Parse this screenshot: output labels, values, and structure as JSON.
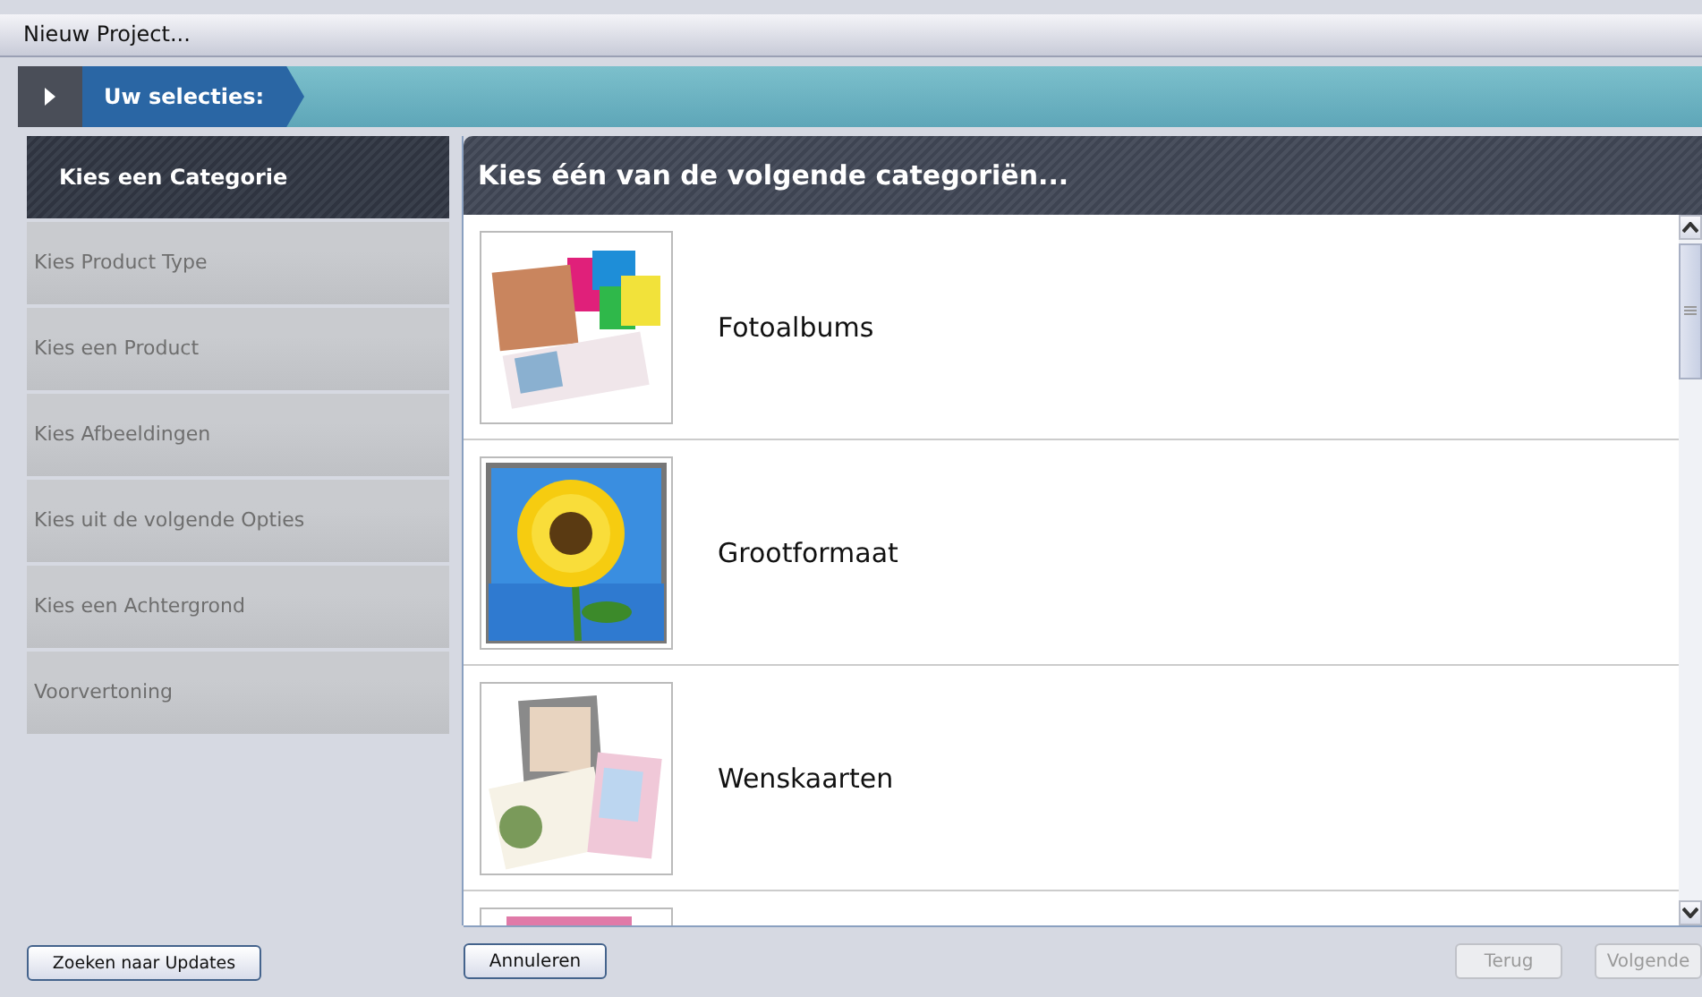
{
  "window": {
    "title": "Nieuw Project..."
  },
  "selection_bar": {
    "label": "Uw selecties:"
  },
  "steps": [
    {
      "label": "Kies een Categorie",
      "selected": true
    },
    {
      "label": "Kies Product Type",
      "selected": false
    },
    {
      "label": "Kies een Product",
      "selected": false
    },
    {
      "label": "Kies Afbeeldingen",
      "selected": false
    },
    {
      "label": "Kies uit de volgende Opties",
      "selected": false
    },
    {
      "label": "Kies een Achtergrond",
      "selected": false
    },
    {
      "label": "Voorvertoning",
      "selected": false
    }
  ],
  "panel": {
    "title": "Kies één van de volgende categoriën..."
  },
  "categories": [
    {
      "label": "Fotoalbums"
    },
    {
      "label": "Grootformaat"
    },
    {
      "label": "Wenskaarten"
    },
    {
      "kind": "picture"
    }
  ],
  "buttons": [
    {
      "label": "Zoeken naar Updates",
      "disabled": false
    },
    {
      "label": "Annuleren",
      "disabled": false
    },
    {
      "label": "Terug",
      "disabled": true
    },
    {
      "label": "Volgende",
      "disabled": true
    }
  ]
}
